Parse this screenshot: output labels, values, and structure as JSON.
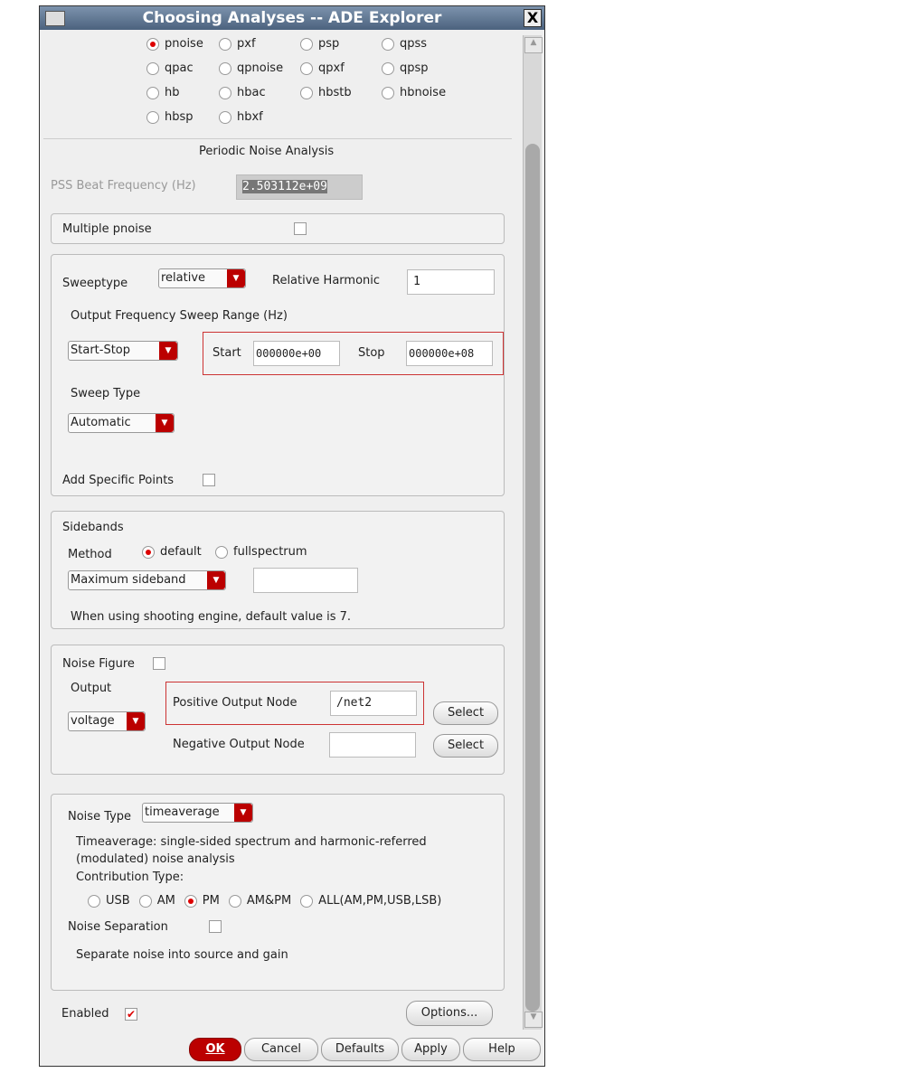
{
  "window": {
    "title": "Choosing Analyses -- ADE Explorer",
    "close": "X"
  },
  "analyses": [
    {
      "label": "pnoise",
      "selected": true
    },
    {
      "label": "pxf"
    },
    {
      "label": "psp"
    },
    {
      "label": "qpss"
    },
    {
      "label": "qpac"
    },
    {
      "label": "qpnoise"
    },
    {
      "label": "qpxf"
    },
    {
      "label": "qpsp"
    },
    {
      "label": "hb"
    },
    {
      "label": "hbac"
    },
    {
      "label": "hbstb"
    },
    {
      "label": "hbnoise"
    },
    {
      "label": "hbsp"
    },
    {
      "label": "hbxf"
    }
  ],
  "section_title": "Periodic Noise Analysis",
  "pss": {
    "label": "PSS Beat Frequency (Hz)",
    "value": "2.503112e+09"
  },
  "multiple": {
    "label": "Multiple pnoise",
    "checked": false
  },
  "sweep": {
    "sweeptype_label": "Sweeptype",
    "sweeptype": "relative",
    "harmonic_label": "Relative Harmonic",
    "harmonic": "1",
    "range_label": "Output Frequency Sweep Range (Hz)",
    "range_mode": "Start-Stop",
    "start_label": "Start",
    "start": "000000e+00",
    "stop_label": "Stop",
    "stop": "000000e+08",
    "sweep_type_label": "Sweep Type",
    "sweep_type": "Automatic",
    "add_points_label": "Add Specific Points"
  },
  "sidebands": {
    "title": "Sidebands",
    "method_label": "Method",
    "opt1": "default",
    "opt2": "fullspectrum",
    "mode": "Maximum sideband",
    "value": "",
    "note": "When using shooting engine, default value is 7."
  },
  "noise": {
    "nf_label": "Noise Figure",
    "output_label": "Output",
    "output": "voltage",
    "pos_label": "Positive Output Node",
    "pos": "/net2",
    "neg_label": "Negative Output Node",
    "neg": "",
    "select": "Select"
  },
  "noise_type": {
    "label": "Noise Type",
    "value": "timeaverage",
    "desc1": "Timeaverage: single-sided spectrum and harmonic-referred",
    "desc2": "(modulated) noise analysis",
    "contrib_label": "Contribution Type:",
    "contrib": [
      "USB",
      "AM",
      "PM",
      "AM&PM",
      "ALL(AM,PM,USB,LSB)"
    ],
    "contrib_selected": "PM",
    "sep_label": "Noise Separation",
    "sep_desc": "Separate noise into source and gain"
  },
  "enabled_label": "Enabled",
  "options": "Options...",
  "buttons": {
    "ok": "OK",
    "cancel": "Cancel",
    "defaults": "Defaults",
    "apply": "Apply",
    "help": "Help"
  },
  "colors": {
    "accent": "#b00000"
  }
}
